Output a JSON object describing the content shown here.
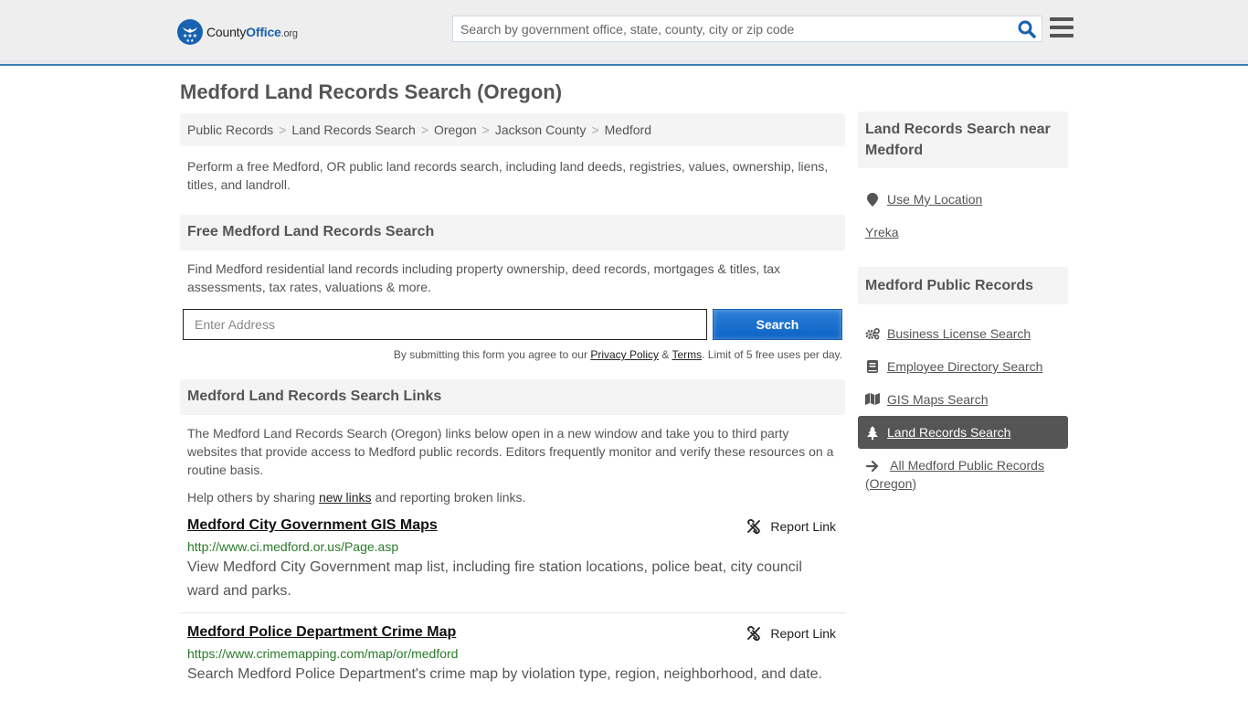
{
  "header": {
    "logo": {
      "brand_part1": "County",
      "brand_part2": "Office",
      "brand_suffix": ".org",
      "icon": "eagle-stars-badge-icon"
    },
    "search": {
      "placeholder": "Search by government office, state, county, city or zip code",
      "value": "",
      "icon": "search-icon"
    },
    "menu_icon": "hamburger-menu-icon"
  },
  "colors": {
    "accent_blue": "#1862b0",
    "header_border": "#3a7db5",
    "url_green": "#2a7a2a",
    "active_item_bg": "#555555",
    "panel_bg": "#f4f4f4"
  },
  "page": {
    "title": "Medford Land Records Search (Oregon)",
    "breadcrumb": [
      {
        "label": "Public Records"
      },
      {
        "label": "Land Records Search"
      },
      {
        "label": "Oregon"
      },
      {
        "label": "Jackson County"
      },
      {
        "label": "Medford"
      }
    ],
    "breadcrumb_separator": ">",
    "intro": "Perform a free Medford, OR public land records search, including land deeds, registries, values, ownership, liens, titles, and landroll."
  },
  "search_section": {
    "heading": "Free Medford Land Records Search",
    "description": "Find Medford residential land records including property ownership, deed records, mortgages & titles, tax assessments, tax rates, valuations & more.",
    "address_placeholder": "Enter Address",
    "address_value": "",
    "button_label": "Search",
    "terms_prefix": "By submitting this form you agree to our ",
    "privacy_label": "Privacy Policy",
    "terms_amp": " & ",
    "terms_label": "Terms",
    "terms_suffix": ". Limit of 5 free uses per day."
  },
  "links_section": {
    "heading": "Medford Land Records Search Links",
    "intro": "The Medford Land Records Search (Oregon) links below open in a new window and take you to third party websites that provide access to Medford public records. Editors frequently monitor and verify these resources on a routine basis.",
    "help_prefix": "Help others by sharing ",
    "help_link": "new links",
    "help_suffix": " and reporting broken links.",
    "report_label": "Report Link",
    "items": [
      {
        "title": "Medford City Government GIS Maps",
        "url": "http://www.ci.medford.or.us/Page.asp",
        "description": "View Medford City Government map list, including fire station locations, police beat, city council ward and parks."
      },
      {
        "title": "Medford Police Department Crime Map",
        "url": "https://www.crimemapping.com/map/or/medford",
        "description": "Search Medford Police Department's crime map by violation type, region, neighborhood, and date."
      }
    ]
  },
  "sidebar": {
    "nearby": {
      "heading": "Land Records Search near Medford",
      "use_location": "Use My Location",
      "places": [
        "Yreka"
      ]
    },
    "public_records": {
      "heading": "Medford Public Records",
      "items": [
        {
          "label": "Business License Search",
          "icon": "gears-icon",
          "active": false
        },
        {
          "label": "Employee Directory Search",
          "icon": "book-icon",
          "active": false
        },
        {
          "label": "GIS Maps Search",
          "icon": "map-icon",
          "active": false
        },
        {
          "label": "Land Records Search",
          "icon": "tree-icon",
          "active": true
        },
        {
          "label": "All Medford Public Records (Oregon)",
          "icon": "arrow-right-icon",
          "active": false
        }
      ]
    }
  }
}
